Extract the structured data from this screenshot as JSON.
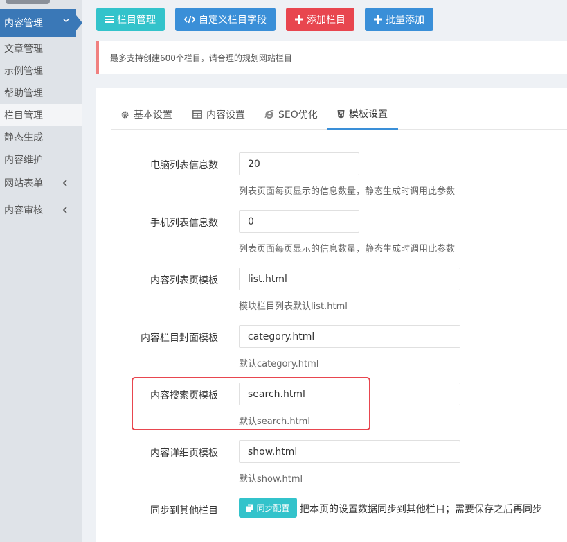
{
  "sidebar": {
    "active_section": "内容管理",
    "items": [
      {
        "label": "文章管理"
      },
      {
        "label": "示例管理"
      },
      {
        "label": "帮助管理"
      },
      {
        "label": "栏目管理"
      },
      {
        "label": "静态生成"
      },
      {
        "label": "内容维护"
      },
      {
        "label": "网站表单"
      },
      {
        "label": "内容审核"
      }
    ]
  },
  "toolbar": {
    "column_manage": "栏目管理",
    "custom_fields": "自定义栏目字段",
    "add_column": "添加栏目",
    "batch_add": "批量添加"
  },
  "notice": {
    "text": "最多支持创建600个栏目，请合理的规划网站栏目"
  },
  "tabs": [
    {
      "label": "基本设置",
      "icon": "gear-icon"
    },
    {
      "label": "内容设置",
      "icon": "table-icon"
    },
    {
      "label": "SEO优化",
      "icon": "ie-icon"
    },
    {
      "label": "模板设置",
      "icon": "html5-icon",
      "active": true
    }
  ],
  "form": {
    "pc_list_count": {
      "label": "电脑列表信息数",
      "value": "20",
      "help": "列表页面每页显示的信息数量，静态生成时调用此参数"
    },
    "mobile_list_count": {
      "label": "手机列表信息数",
      "value": "0",
      "help": "列表页面每页显示的信息数量，静态生成时调用此参数"
    },
    "list_template": {
      "label": "内容列表页模板",
      "value": "list.html",
      "help": "模块栏目列表默认list.html"
    },
    "category_template": {
      "label": "内容栏目封面模板",
      "value": "category.html",
      "help": "默认category.html"
    },
    "search_template": {
      "label": "内容搜索页模板",
      "value": "search.html",
      "help": "默认search.html"
    },
    "show_template": {
      "label": "内容详细页模板",
      "value": "show.html",
      "help": "默认show.html"
    },
    "sync": {
      "label": "同步到其他栏目",
      "button": "同步配置",
      "text": "把本页的设置数据同步到其他栏目；需要保存之后再同步"
    }
  },
  "colors": {
    "sidebar_active": "#3a78b7",
    "info": "#33c3cb",
    "primary": "#3a8fd8",
    "danger": "#e8464f"
  }
}
